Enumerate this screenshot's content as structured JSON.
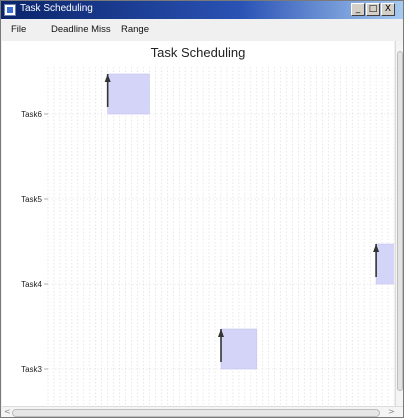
{
  "window": {
    "title": "Task Scheduling",
    "minimize_label": "_",
    "maximize_label": "□",
    "close_label": "X"
  },
  "menu": {
    "items": [
      {
        "label": "File"
      },
      {
        "label": "Deadline Miss"
      },
      {
        "label": "Range"
      }
    ]
  },
  "chart": {
    "title": "Task Scheduling",
    "tasks": [
      "Task6",
      "Task5",
      "Task4",
      "Task3"
    ],
    "block_color": "#d4d4f8",
    "block_border": "#c4c4f0",
    "arrow_color": "#333333",
    "grid_color": "#d8d8d8"
  },
  "chart_data": {
    "type": "gantt",
    "title": "Task Scheduling",
    "categories": [
      "Task6",
      "Task5",
      "Task4",
      "Task3"
    ],
    "blocks": [
      {
        "task": "Task6",
        "start": 10,
        "duration": 7,
        "release_arrow": true
      },
      {
        "task": "Task3",
        "start": 29,
        "duration": 6,
        "release_arrow": true
      },
      {
        "task": "Task4",
        "start": 55,
        "duration": 4,
        "release_arrow": true
      }
    ],
    "xlim": [
      0,
      58
    ],
    "grid": true
  },
  "scrollbars": {
    "left_arrow": "<",
    "right_arrow": ">",
    "up_arrow": "^",
    "down_arrow": "v"
  }
}
